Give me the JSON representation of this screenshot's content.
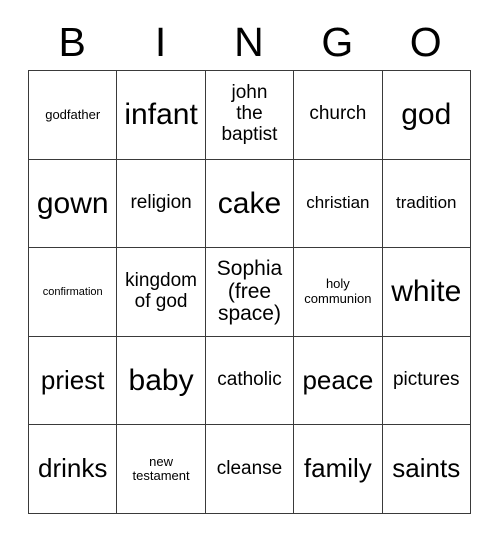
{
  "card": {
    "header_letters": [
      "B",
      "I",
      "N",
      "G",
      "O"
    ],
    "free_space_label": "Sophia (free space)",
    "border_color": "#3a3a3a",
    "background_color": "#ffffff",
    "text_color": "#000000",
    "columns": 5,
    "rows": 5,
    "cells": [
      [
        {
          "text": "godfather",
          "size": "sz-s"
        },
        {
          "text": "infant",
          "size": "sz-xxl"
        },
        {
          "text": "john\nthe\nbaptist",
          "size": "sz-ml"
        },
        {
          "text": "church",
          "size": "sz-ml"
        },
        {
          "text": "god",
          "size": "sz-xxl"
        }
      ],
      [
        {
          "text": "gown",
          "size": "sz-xxl"
        },
        {
          "text": "religion",
          "size": "sz-ml"
        },
        {
          "text": "cake",
          "size": "sz-xxl"
        },
        {
          "text": "christian",
          "size": "sz-m"
        },
        {
          "text": "tradition",
          "size": "sz-m"
        }
      ],
      [
        {
          "text": "confirmation",
          "size": "sz-xs"
        },
        {
          "text": "kingdom\nof god",
          "size": "sz-ml"
        },
        {
          "text": "Sophia\n(free\nspace)",
          "size": "sz-l"
        },
        {
          "text": "holy\ncommunion",
          "size": "sz-s"
        },
        {
          "text": "white",
          "size": "sz-xxl"
        }
      ],
      [
        {
          "text": "priest",
          "size": "sz-xl"
        },
        {
          "text": "baby",
          "size": "sz-xxl"
        },
        {
          "text": "catholic",
          "size": "sz-ml"
        },
        {
          "text": "peace",
          "size": "sz-xl"
        },
        {
          "text": "pictures",
          "size": "sz-ml"
        }
      ],
      [
        {
          "text": "drinks",
          "size": "sz-xl"
        },
        {
          "text": "new\ntestament",
          "size": "sz-s"
        },
        {
          "text": "cleanse",
          "size": "sz-ml"
        },
        {
          "text": "family",
          "size": "sz-xl"
        },
        {
          "text": "saints",
          "size": "sz-xl"
        }
      ]
    ]
  }
}
